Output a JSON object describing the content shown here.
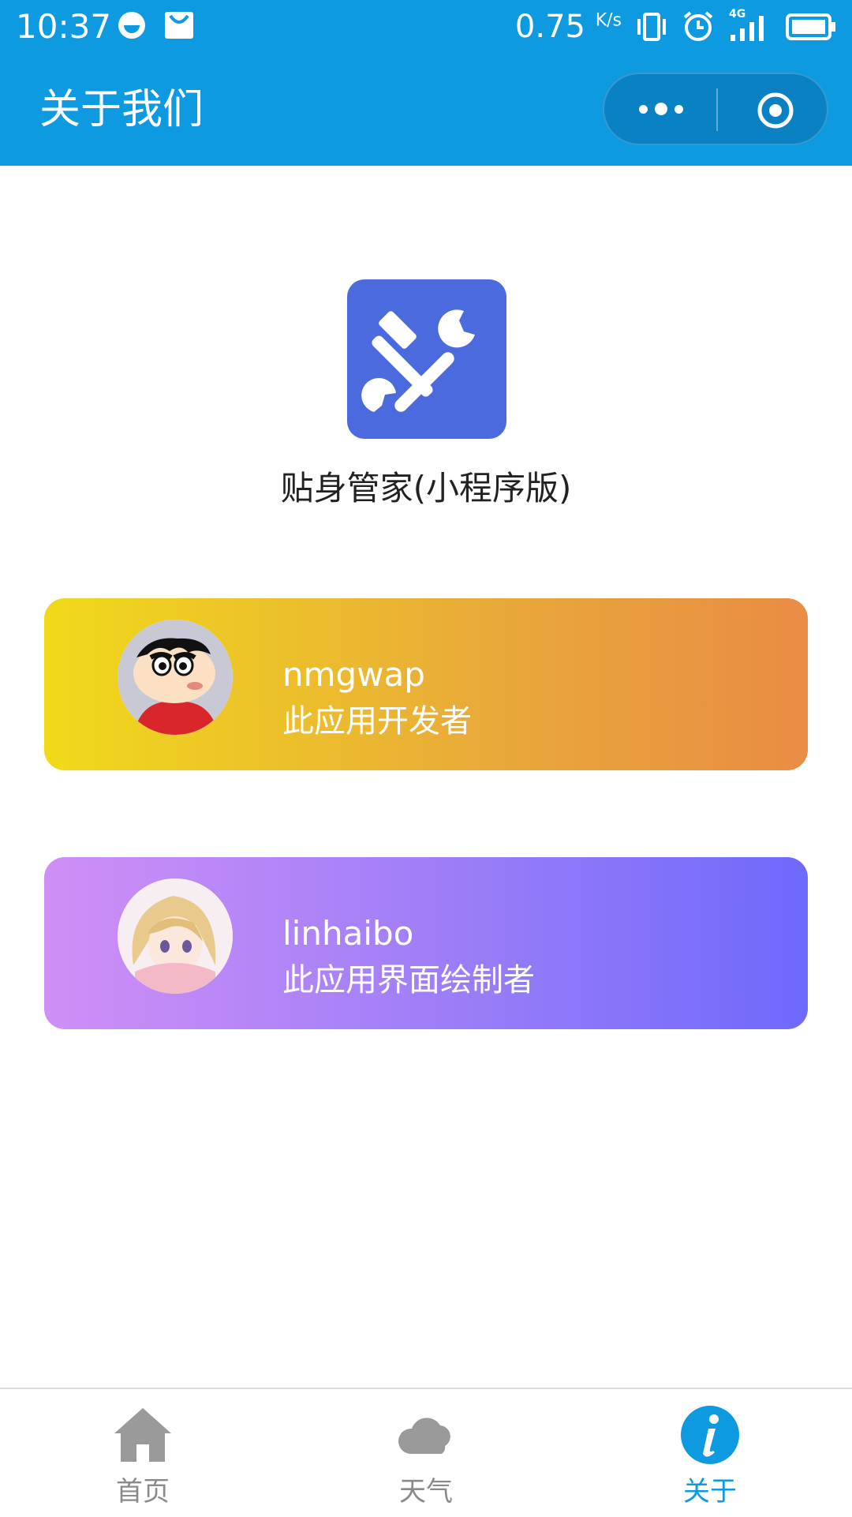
{
  "status_bar": {
    "time": "10:37",
    "net_speed": "0.75",
    "net_unit": "K/s",
    "signal_label": "4G",
    "icons": [
      "smiley-icon",
      "mail-icon",
      "vibrate-icon",
      "alarm-icon",
      "signal-icon",
      "battery-icon"
    ]
  },
  "nav": {
    "title": "关于我们",
    "more_icon": "more-dots-icon",
    "close_icon": "target-icon"
  },
  "app": {
    "name": "贴身管家(小程序版)",
    "logo_icon": "tools-icon",
    "logo_color": "#4a6ade"
  },
  "people": [
    {
      "name": "nmgwap",
      "role": "此应用开发者",
      "gradient": [
        "#f0da1a",
        "#e98c44"
      ]
    },
    {
      "name": "linhaibo",
      "role": "此应用界面绘制者",
      "gradient": [
        "#d08ff6",
        "#6e69fb"
      ]
    }
  ],
  "tabbar": {
    "items": [
      {
        "label": "首页",
        "icon": "home-icon",
        "active": false
      },
      {
        "label": "天气",
        "icon": "cloud-icon",
        "active": false
      },
      {
        "label": "关于",
        "icon": "info-icon",
        "active": true
      }
    ],
    "active_color": "#0e9ae0",
    "inactive_color": "#8a8a8a"
  },
  "colors": {
    "header": "#0e9ae0",
    "background": "#ffffff"
  }
}
